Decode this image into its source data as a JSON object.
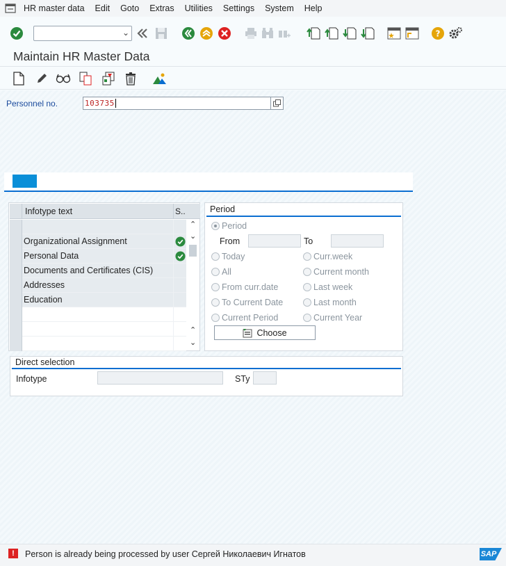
{
  "menubar": {
    "items": [
      {
        "label": "HR master data",
        "underline": "H"
      },
      {
        "label": "Edit",
        "underline": "E"
      },
      {
        "label": "Goto",
        "underline": "G"
      },
      {
        "label": "Extras",
        "underline": "x"
      },
      {
        "label": "Utilities",
        "underline": "U"
      },
      {
        "label": "Settings",
        "underline": "S"
      },
      {
        "label": "System",
        "underline": "y"
      },
      {
        "label": "Help",
        "underline": "H"
      }
    ]
  },
  "toolbar": {
    "command_value": ""
  },
  "title": "Maintain HR Master Data",
  "pernr": {
    "label": "Personnel no.",
    "value": "103735"
  },
  "infotypes": {
    "header": "Infotype text",
    "status_header": "S..",
    "rows": [
      {
        "label": "",
        "status": "",
        "filled": true
      },
      {
        "label": "Organizational Assignment",
        "status": "check",
        "filled": true
      },
      {
        "label": "Personal Data",
        "status": "check",
        "filled": true
      },
      {
        "label": "Documents and Certificates (CIS)",
        "status": "",
        "filled": true
      },
      {
        "label": "Addresses",
        "status": "",
        "filled": true
      },
      {
        "label": "Education",
        "status": "",
        "filled": true
      },
      {
        "label": "",
        "status": "",
        "filled": false
      },
      {
        "label": "",
        "status": "",
        "filled": false
      },
      {
        "label": "",
        "status": "",
        "filled": false
      }
    ]
  },
  "period": {
    "title": "Period",
    "period_label": "Period",
    "from_label": "From",
    "to_label": "To",
    "options_left": [
      "Today",
      "All",
      "From curr.date",
      "To Current Date",
      "Current Period"
    ],
    "options_right": [
      "Curr.week",
      "Current month",
      "Last week",
      "Last month",
      "Current Year"
    ],
    "choose_label": "Choose"
  },
  "direct": {
    "title": "Direct selection",
    "infotype_label": "Infotype",
    "sty_label": "STy"
  },
  "status": {
    "message": "Person is already being processed by user Сергей Николаевич Игнатов",
    "logo": "SAP"
  },
  "colors": {
    "accent": "#0a6ed1",
    "green": "#2b8a3e",
    "gold": "#e5a50a",
    "red": "#d22"
  }
}
